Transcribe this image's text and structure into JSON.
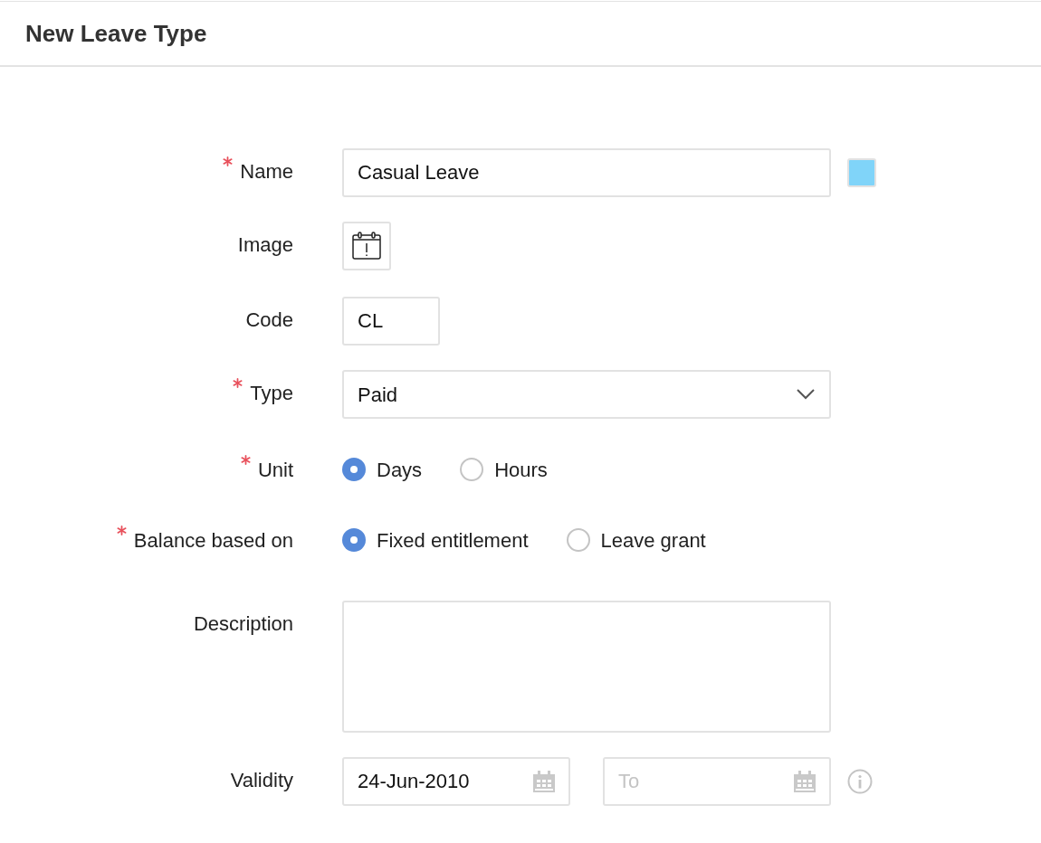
{
  "title": "New Leave Type",
  "fields": [
    {
      "kind": "text",
      "label": "Name",
      "required": true,
      "value": "Casual Leave",
      "color": "#80d4f9"
    },
    {
      "kind": "image",
      "label": "Image",
      "required": false
    },
    {
      "kind": "code",
      "label": "Code",
      "required": false,
      "value": "CL"
    },
    {
      "kind": "select",
      "label": "Type",
      "required": true,
      "value": "Paid"
    },
    {
      "kind": "radio",
      "label": "Unit",
      "required": true,
      "options": [
        {
          "label": "Days",
          "selected": true
        },
        {
          "label": "Hours",
          "selected": false
        }
      ]
    },
    {
      "kind": "radio",
      "label": "Balance based on",
      "required": true,
      "options": [
        {
          "label": "Fixed entitlement",
          "selected": true
        },
        {
          "label": "Leave grant",
          "selected": false
        }
      ]
    },
    {
      "kind": "textarea",
      "label": "Description",
      "required": false
    },
    {
      "kind": "daterange",
      "label": "Validity",
      "required": false,
      "from": "24-Jun-2010",
      "to_placeholder": "To"
    }
  ]
}
